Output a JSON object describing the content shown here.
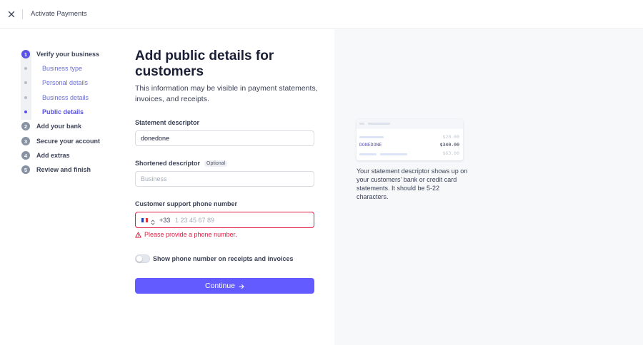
{
  "topbar": {
    "title": "Activate Payments"
  },
  "steps": [
    {
      "number": "1",
      "label": "Verify your business",
      "active": true
    },
    {
      "number": "2",
      "label": "Add your bank"
    },
    {
      "number": "3",
      "label": "Secure your account"
    },
    {
      "number": "4",
      "label": "Add extras"
    },
    {
      "number": "5",
      "label": "Review and finish"
    }
  ],
  "substeps": [
    {
      "label": "Business type"
    },
    {
      "label": "Personal details"
    },
    {
      "label": "Business details"
    },
    {
      "label": "Public details",
      "active": true
    }
  ],
  "form": {
    "heading": "Add public details for customers",
    "intro": "This information may be visible in payment statements, invoices, and receipts.",
    "statement_descriptor": {
      "label": "Statement descriptor",
      "value": "donedone"
    },
    "shortened_descriptor": {
      "label": "Shortened descriptor",
      "optional": "Optional",
      "placeholder": "Business"
    },
    "phone": {
      "label": "Customer support phone number",
      "dial_code": "+33",
      "placeholder": "1 23 45 67 89",
      "error": "Please provide a phone number."
    },
    "toggle": {
      "label": "Show phone number on receipts and invoices",
      "on": false
    },
    "continue_label": "Continue"
  },
  "preview": {
    "amounts": [
      "$20.00",
      "$340.00",
      "$63.00"
    ],
    "descriptor": "DONEDONE",
    "text": "Your statement descriptor shows up on your customers' bank or credit card statements. It should be 5-22 characters."
  },
  "colors": {
    "accent": "#635bff",
    "error": "#df1b41",
    "panel": "#f6f8fa"
  }
}
